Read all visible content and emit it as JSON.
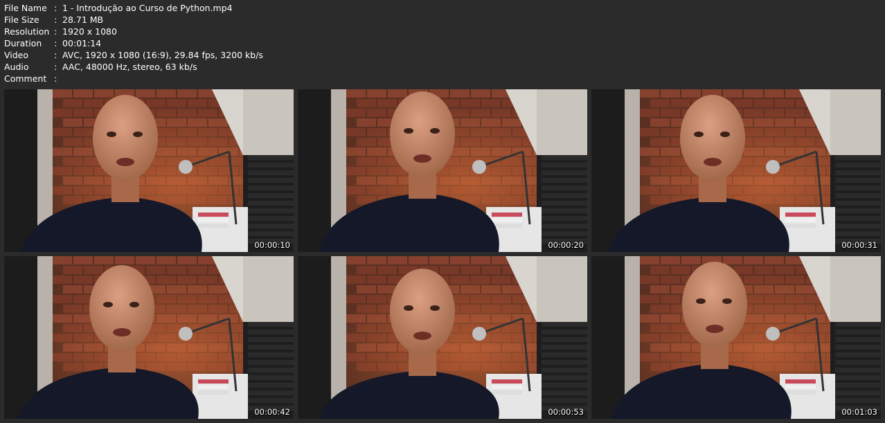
{
  "metadata": {
    "rows": [
      {
        "label": "File Name",
        "value": "1 - Introdução ao Curso de Python.mp4"
      },
      {
        "label": "File Size",
        "value": "28.71 MB"
      },
      {
        "label": "Resolution",
        "value": "1920 x 1080"
      },
      {
        "label": "Duration",
        "value": "00:01:14"
      },
      {
        "label": "Video",
        "value": "AVC, 1920 x 1080 (16:9), 29.84 fps, 3200 kb/s"
      },
      {
        "label": "Audio",
        "value": "AAC, 48000 Hz, stereo, 63 kb/s"
      },
      {
        "label": "Comment",
        "value": ""
      }
    ],
    "separator": ":"
  },
  "thumbnails": [
    {
      "timestamp": "00:00:10"
    },
    {
      "timestamp": "00:00:20"
    },
    {
      "timestamp": "00:00:31"
    },
    {
      "timestamp": "00:00:42"
    },
    {
      "timestamp": "00:00:53"
    },
    {
      "timestamp": "00:01:03"
    }
  ],
  "colors": {
    "background": "#2b2b2b",
    "brick": "#7a3a28",
    "wall": "#c9c4bc",
    "shirt": "#141828",
    "skin": "#c58a6a"
  }
}
